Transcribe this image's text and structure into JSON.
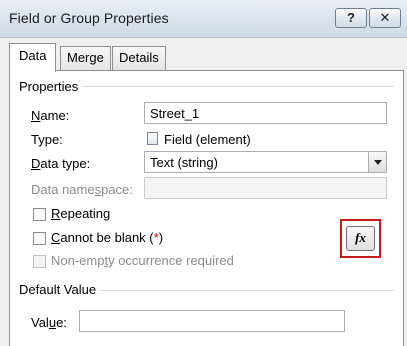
{
  "window": {
    "title": "Field or Group Properties",
    "help_label": "?",
    "close_label": "✕"
  },
  "tabs": [
    {
      "label": "Data",
      "active": true
    },
    {
      "label": "Merge",
      "active": false
    },
    {
      "label": "Details",
      "active": false
    }
  ],
  "properties": {
    "section_title": "Properties",
    "name_label_pre": "",
    "name_label_key": "N",
    "name_label_post": "ame:",
    "name_value": "Street_1",
    "type_label": "Type:",
    "type_value": "Field (element)",
    "type_icon": "field-element-icon",
    "datatype_label_key": "D",
    "datatype_label_post": "ata type:",
    "datatype_value": "Text (string)",
    "namespace_label_pre": "Data name",
    "namespace_label_key": "s",
    "namespace_label_post": "pace:",
    "namespace_value": "",
    "repeating_key": "R",
    "repeating_post": "epeating",
    "repeating_checked": false,
    "blank_key": "C",
    "blank_post": "annot be blank (",
    "blank_star": "*",
    "blank_close": ")",
    "blank_checked": false,
    "nonempty_pre": "Non-emp",
    "nonempty_key": "t",
    "nonempty_post": "y occurrence required",
    "nonempty_checked": false
  },
  "default_value": {
    "section_title": "Default Value",
    "value_label_pre": "Val",
    "value_label_key": "u",
    "value_label_post": "e:",
    "value": "",
    "fx_label": "fx",
    "highlight_color": "#c21c1c"
  },
  "colors": {
    "required_star": "#e00000"
  }
}
